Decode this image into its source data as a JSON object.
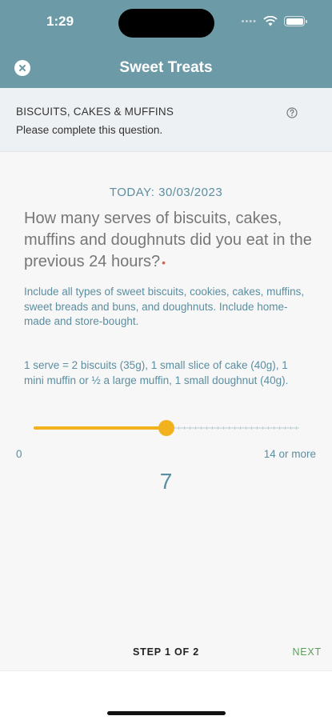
{
  "status_bar": {
    "time": "1:29",
    "icons": [
      "signal-dots-icon",
      "wifi-icon",
      "battery-icon"
    ]
  },
  "header": {
    "title": "Sweet Treats",
    "close_icon": "close-icon"
  },
  "question_banner": {
    "section_title": "BISCUITS, CAKES & MUFFINS",
    "subtitle": "Please complete this question.",
    "help_icon": "help-icon"
  },
  "main": {
    "today": "TODAY: 30/03/2023",
    "question": "How many serves of biscuits, cakes, muffins and doughnuts did you eat in the previous 24 hours?",
    "required_marker": "•",
    "instruction": "Include all types of sweet biscuits, cookies, cakes, muffins, sweet breads and buns, and doughnuts. Include home-made and store-bought.",
    "serve_info": "1 serve = 2 biscuits (35g), 1 small slice of cake (40g), 1 mini muffin or ½ a large muffin, 1 small doughnut (40g).",
    "slider": {
      "min": 0,
      "max": 14,
      "value": 7,
      "min_label": "0",
      "max_label": "14 or more",
      "value_label": "7",
      "accent_color": "#f2b21d"
    }
  },
  "footer_nav": {
    "step": "STEP 1 OF 2",
    "next": "NEXT"
  },
  "colors": {
    "header_bg": "#6d9aa7",
    "accent_text": "#5b8ea0",
    "next": "#5aa05a"
  }
}
